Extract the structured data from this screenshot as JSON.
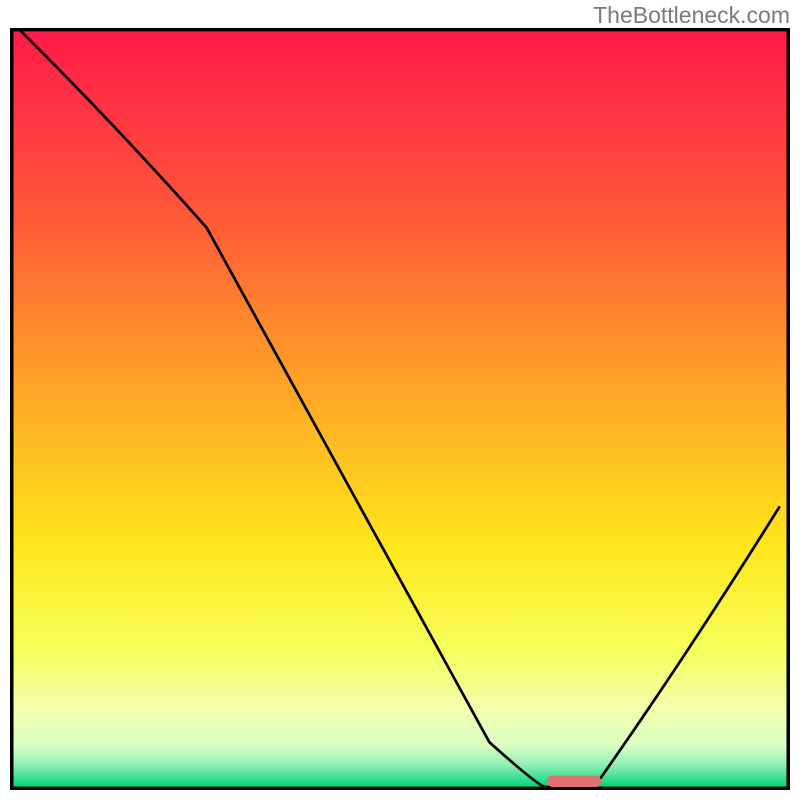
{
  "watermark": "TheBottleneck.com",
  "chart_data": {
    "type": "line",
    "title": "",
    "xlabel": "",
    "ylabel": "",
    "xlim": [
      0,
      100
    ],
    "ylim": [
      0,
      100
    ],
    "grid": false,
    "x": [
      1,
      25,
      68,
      75,
      99
    ],
    "values": [
      100,
      74,
      0,
      0,
      37
    ],
    "marker": {
      "x_range": [
        69,
        76
      ],
      "color": "#e17272"
    },
    "gradient_stops": [
      {
        "offset": 0.0,
        "color": "#ff1a4a"
      },
      {
        "offset": 0.22,
        "color": "#ff5139"
      },
      {
        "offset": 0.48,
        "color": "#ffa726"
      },
      {
        "offset": 0.68,
        "color": "#ffe61a"
      },
      {
        "offset": 0.82,
        "color": "#f6ff5c"
      },
      {
        "offset": 0.9,
        "color": "#f1ffb0"
      },
      {
        "offset": 0.945,
        "color": "#daffc2"
      },
      {
        "offset": 0.97,
        "color": "#93f0b6"
      },
      {
        "offset": 1.0,
        "color": "#00d477"
      }
    ],
    "frame_color": "#000000"
  }
}
